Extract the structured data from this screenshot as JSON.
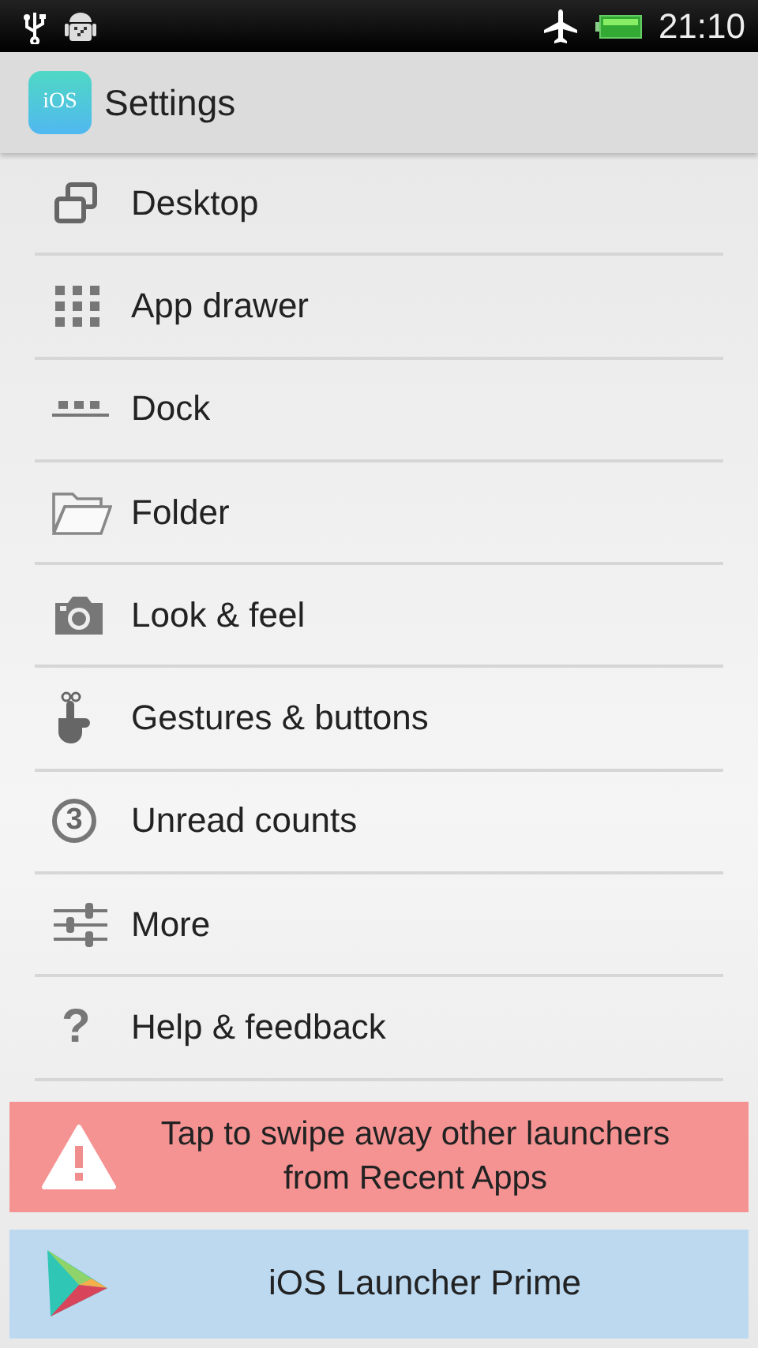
{
  "status_bar": {
    "time": "21:10"
  },
  "app_bar": {
    "logo_text": "iOS",
    "title": "Settings"
  },
  "items": [
    {
      "label": "Desktop"
    },
    {
      "label": "App drawer"
    },
    {
      "label": "Dock"
    },
    {
      "label": "Folder"
    },
    {
      "label": "Look & feel"
    },
    {
      "label": "Gestures & buttons"
    },
    {
      "label": "Unread counts",
      "icon_text": "3"
    },
    {
      "label": "More"
    },
    {
      "label": "Help & feedback",
      "icon_text": "?"
    }
  ],
  "warning_banner": {
    "text": "Tap to swipe away other launchers from Recent Apps"
  },
  "promo_banner": {
    "text": "iOS Launcher Prime"
  }
}
